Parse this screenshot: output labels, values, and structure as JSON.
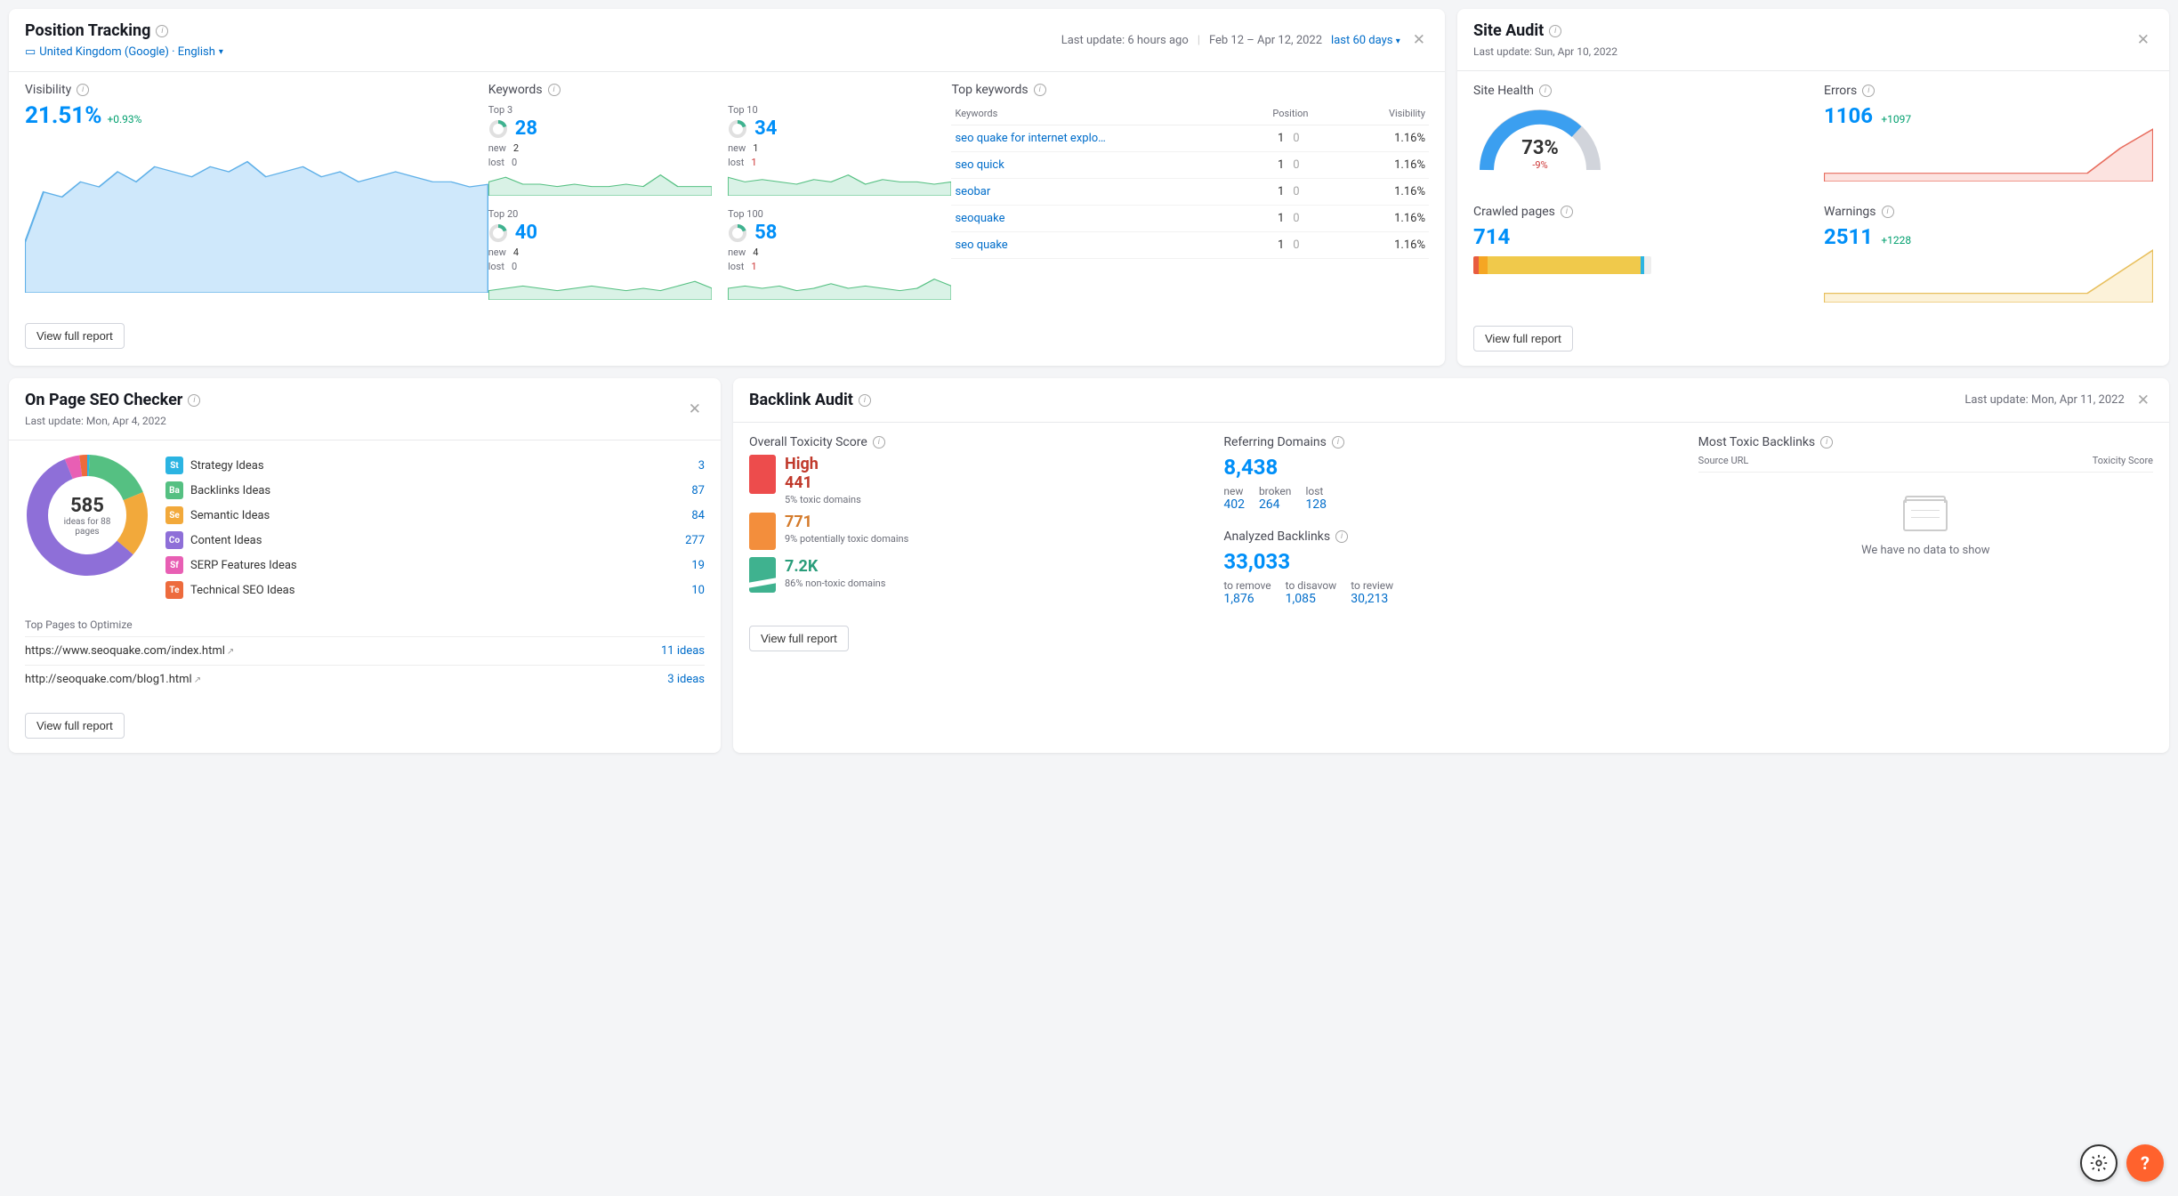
{
  "position_tracking": {
    "title": "Position Tracking",
    "last_update": "Last update: 6 hours ago",
    "date_range": "Feb 12 – Apr 12, 2022",
    "period": "last 60 days",
    "locale": "United Kingdom (Google) · English",
    "visibility": {
      "label": "Visibility",
      "value": "21.51%",
      "delta": "+0.93%"
    },
    "keywords_label": "Keywords",
    "kw_groups": [
      {
        "label": "Top 3",
        "value": "28",
        "new": "2",
        "lost": "0"
      },
      {
        "label": "Top 10",
        "value": "34",
        "new": "1",
        "lost": "1"
      },
      {
        "label": "Top 20",
        "value": "40",
        "new": "4",
        "lost": "0"
      },
      {
        "label": "Top 100",
        "value": "58",
        "new": "4",
        "lost": "1"
      }
    ],
    "top_keywords": {
      "label": "Top keywords",
      "headers": [
        "Keywords",
        "Position",
        "Visibility"
      ],
      "rows": [
        {
          "kw": "seo quake for internet explo…",
          "pos": "1",
          "ppos": "0",
          "vis": "1.16%"
        },
        {
          "kw": "seo quick",
          "pos": "1",
          "ppos": "0",
          "vis": "1.16%"
        },
        {
          "kw": "seobar",
          "pos": "1",
          "ppos": "0",
          "vis": "1.16%"
        },
        {
          "kw": "seoquake",
          "pos": "1",
          "ppos": "0",
          "vis": "1.16%"
        },
        {
          "kw": "seo quake",
          "pos": "1",
          "ppos": "0",
          "vis": "1.16%"
        }
      ]
    },
    "view_full": "View full report"
  },
  "site_audit": {
    "title": "Site Audit",
    "last_update": "Last update: Sun, Apr 10, 2022",
    "health": {
      "label": "Site Health",
      "value": "73%",
      "delta": "-9%"
    },
    "errors": {
      "label": "Errors",
      "value": "1106",
      "delta": "+1097"
    },
    "crawled": {
      "label": "Crawled pages",
      "value": "714"
    },
    "warnings": {
      "label": "Warnings",
      "value": "2511",
      "delta": "+1228"
    },
    "view_full": "View full report"
  },
  "on_page": {
    "title": "On Page SEO Checker",
    "last_update": "Last update: Mon, Apr 4, 2022",
    "total": "585",
    "total_sub": "ideas for 88 pages",
    "ideas": [
      {
        "badge": "St",
        "color": "#2bb4e2",
        "name": "Strategy Ideas",
        "count": "3"
      },
      {
        "badge": "Ba",
        "color": "#55c082",
        "name": "Backlinks Ideas",
        "count": "87"
      },
      {
        "badge": "Se",
        "color": "#f2a93b",
        "name": "Semantic Ideas",
        "count": "84"
      },
      {
        "badge": "Co",
        "color": "#8e6fd8",
        "name": "Content Ideas",
        "count": "277"
      },
      {
        "badge": "Sf",
        "color": "#e85fb4",
        "name": "SERP Features Ideas",
        "count": "19"
      },
      {
        "badge": "Te",
        "color": "#ed6b3d",
        "name": "Technical SEO Ideas",
        "count": "10"
      }
    ],
    "top_pages": {
      "label": "Top Pages to Optimize",
      "rows": [
        {
          "url": "https://www.seoquake.com/index.html",
          "count": "11 ideas"
        },
        {
          "url": "http://seoquake.com/blog1.html",
          "count": "3 ideas"
        }
      ]
    },
    "view_full": "View full report"
  },
  "backlink_audit": {
    "title": "Backlink Audit",
    "last_update": "Last update: Mon, Apr 11, 2022",
    "toxicity": {
      "label": "Overall Toxicity Score",
      "level": "High",
      "rows": [
        {
          "v": "441",
          "sub": "5% toxic domains",
          "color": "#c0392b"
        },
        {
          "v": "771",
          "sub": "9% potentially toxic domains",
          "color": "#d47b2c"
        },
        {
          "v": "7.2K",
          "sub": "86% non-toxic domains",
          "color": "#2a9d7b"
        }
      ]
    },
    "ref_domains": {
      "label": "Referring Domains",
      "value": "8,438",
      "sub": [
        {
          "l": "new",
          "v": "402"
        },
        {
          "l": "broken",
          "v": "264"
        },
        {
          "l": "lost",
          "v": "128"
        }
      ]
    },
    "analyzed": {
      "label": "Analyzed Backlinks",
      "value": "33,033",
      "sub": [
        {
          "l": "to remove",
          "v": "1,876"
        },
        {
          "l": "to disavow",
          "v": "1,085"
        },
        {
          "l": "to review",
          "v": "30,213"
        }
      ]
    },
    "toxic_backlinks": {
      "label": "Most Toxic Backlinks",
      "headers": [
        "Source URL",
        "Toxicity Score"
      ],
      "empty": "We have no data to show"
    },
    "view_full": "View full report"
  },
  "chart_data": {
    "visibility_chart": {
      "type": "area",
      "ylim": [
        0,
        30
      ],
      "values": [
        10,
        20,
        19,
        22,
        21,
        24,
        22,
        25,
        24,
        23,
        25,
        24,
        26,
        23,
        24,
        25,
        23,
        24,
        22,
        23,
        24,
        23,
        22,
        22,
        21,
        21.5
      ]
    },
    "kw_sparks": [
      [
        6,
        8,
        5,
        5,
        4,
        5,
        4,
        4,
        5,
        4,
        9,
        4,
        4,
        4
      ],
      [
        8,
        6,
        7,
        6,
        5,
        7,
        6,
        9,
        5,
        7,
        6,
        6,
        5,
        6
      ],
      [
        4,
        5,
        6,
        5,
        4,
        5,
        6,
        5,
        4,
        5,
        4,
        6,
        8,
        5
      ],
      [
        5,
        6,
        5,
        6,
        4,
        5,
        7,
        5,
        6,
        5,
        4,
        5,
        9,
        6
      ]
    ],
    "errors_chart": {
      "type": "line",
      "values": [
        8,
        8,
        8,
        8,
        8,
        8,
        8,
        8,
        8,
        60,
        100
      ]
    },
    "warnings_chart": {
      "type": "line",
      "values": [
        10,
        10,
        10,
        10,
        10,
        10,
        10,
        10,
        10,
        55,
        100
      ]
    },
    "crawled_bar": [
      {
        "c": "#e85c3f",
        "w": 3
      },
      {
        "c": "#f5a623",
        "w": 5
      },
      {
        "c": "#f0c94b",
        "w": 86
      },
      {
        "c": "#2bb4e2",
        "w": 2
      },
      {
        "c": "#eee",
        "w": 4
      }
    ],
    "onpage_donut": [
      {
        "c": "#2bb4e2",
        "v": 3
      },
      {
        "c": "#55c082",
        "v": 87
      },
      {
        "c": "#f2a93b",
        "v": 84
      },
      {
        "c": "#8e6fd8",
        "v": 277
      },
      {
        "c": "#e85fb4",
        "v": 19
      },
      {
        "c": "#ed6b3d",
        "v": 10
      }
    ]
  }
}
